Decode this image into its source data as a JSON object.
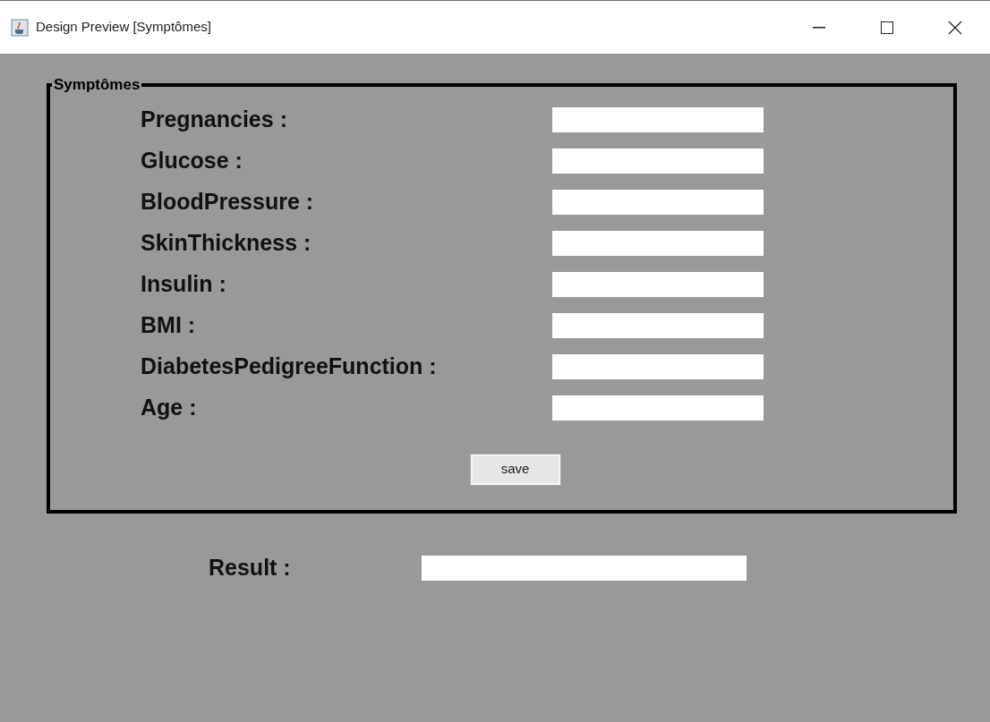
{
  "window": {
    "title": "Design Preview [Symptômes]"
  },
  "panel": {
    "title": "Symptômes",
    "fields": [
      {
        "label": "Pregnancies :"
      },
      {
        "label": "Glucose :"
      },
      {
        "label": "BloodPressure :"
      },
      {
        "label": "SkinThickness :"
      },
      {
        "label": "Insulin :"
      },
      {
        "label": "BMI :"
      },
      {
        "label": "DiabetesPedigreeFunction :"
      },
      {
        "label": "Age :"
      }
    ],
    "button": "save"
  },
  "result": {
    "label": "Result :"
  }
}
